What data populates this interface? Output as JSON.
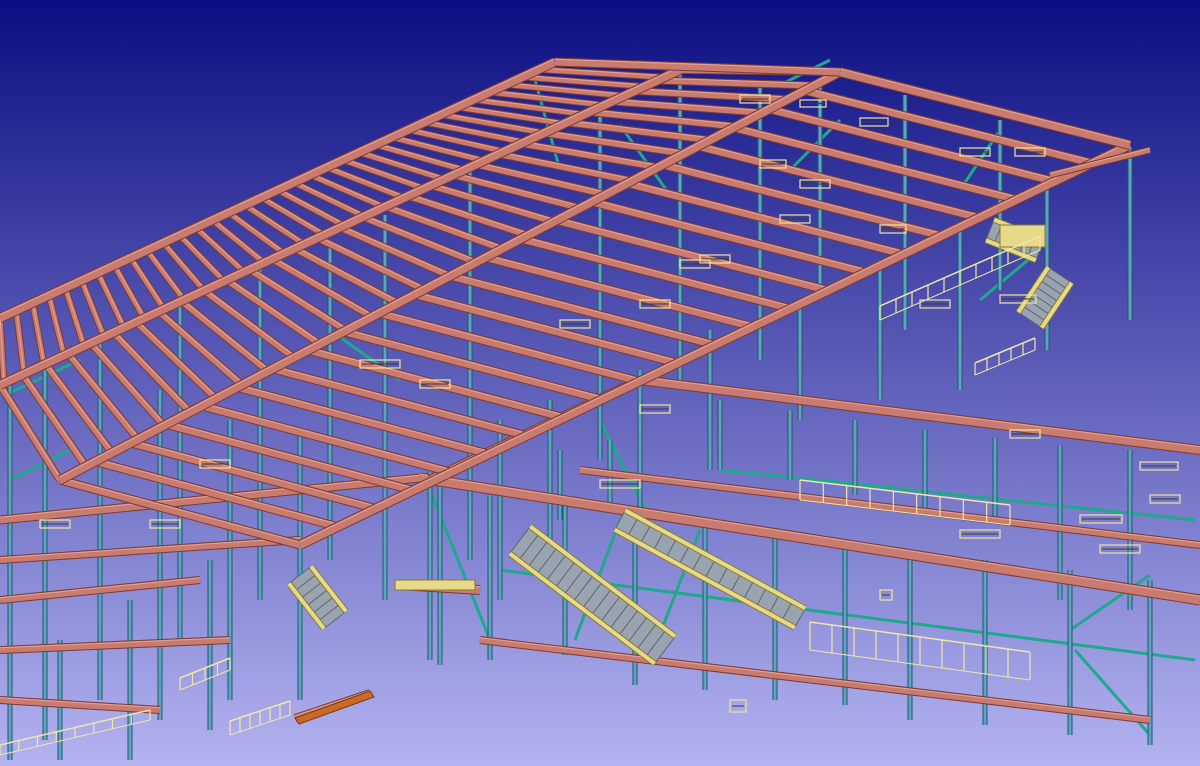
{
  "viewport": {
    "background_top": "#0b0d82",
    "background_bottom": "#b3b3f1"
  },
  "colors": {
    "beam": "#c87b6e",
    "beam_edge": "#7a3b34",
    "beam_top": "#e4a394",
    "column": "#5fa3c0",
    "column_edge": "#23566c",
    "brace": "#1fa98c",
    "stair": "#e6d98a",
    "stair_edge": "#8b7b2c",
    "rail": "#f0e6a8",
    "tread": "#9aa4b0"
  }
}
